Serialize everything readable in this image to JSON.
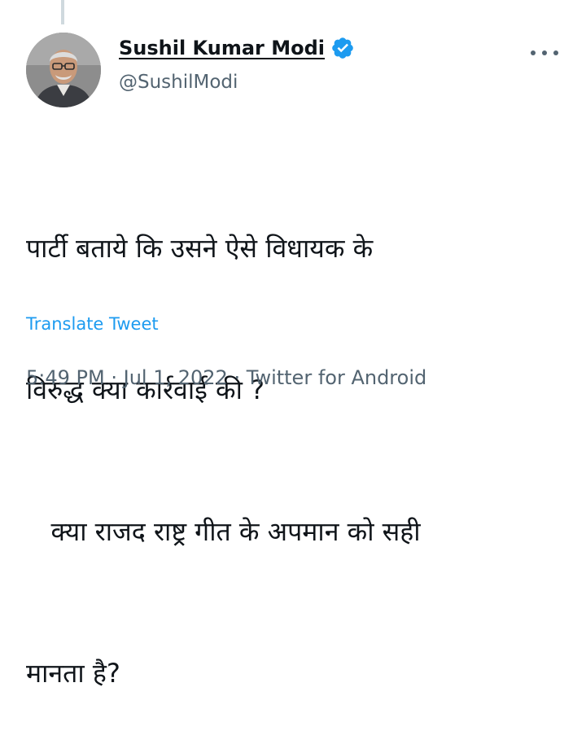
{
  "tweet": {
    "author": {
      "name": "Sushil Kumar Modi",
      "handle": "@SushilModi",
      "verified": true,
      "verified_icon": "verified-badge-icon",
      "avatar_icon": "profile-photo"
    },
    "more_icon": "more-options-icon",
    "text_lines": [
      "पार्टी बताये कि उसने ऐसे विधायक के",
      "विरुद्ध क्या कार्रवाई की ?",
      "   क्या राजद राष्ट्र गीत के अपमान को सही",
      "मानता है?"
    ],
    "translate_label": "Translate Tweet",
    "meta": {
      "time": "5:49 PM",
      "separator": "·",
      "date": "Jul 1, 2022",
      "source": "Twitter for Android"
    }
  },
  "colors": {
    "text": "#0f1419",
    "secondary": "#536471",
    "link": "#1d9bf0",
    "verified": "#1d9bf0",
    "thread_line": "#cfd9de"
  }
}
